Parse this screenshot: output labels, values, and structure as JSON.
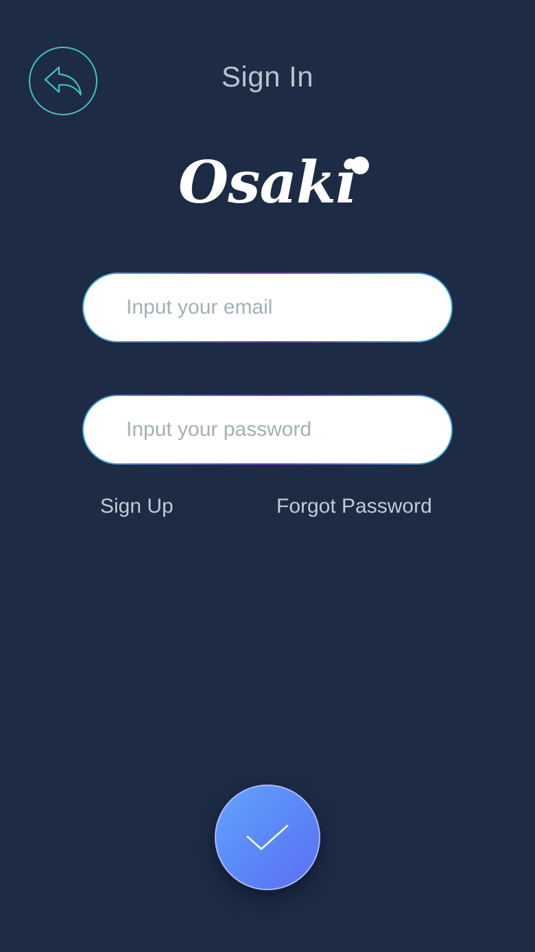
{
  "header": {
    "title": "Sign In",
    "back_icon": "reply-arrow-icon"
  },
  "logo": {
    "text": "Osaki"
  },
  "form": {
    "email_placeholder": "Input your email",
    "password_placeholder": "Input your password",
    "email_value": "",
    "password_value": ""
  },
  "links": {
    "sign_up": "Sign Up",
    "forgot_password": "Forgot Password"
  },
  "submit": {
    "icon": "checkmark-icon"
  },
  "colors": {
    "background": "#1d2b45",
    "accent_teal": "#3fc7bd",
    "button_blue": "#5a86f7",
    "text_muted": "#c3cad6"
  }
}
